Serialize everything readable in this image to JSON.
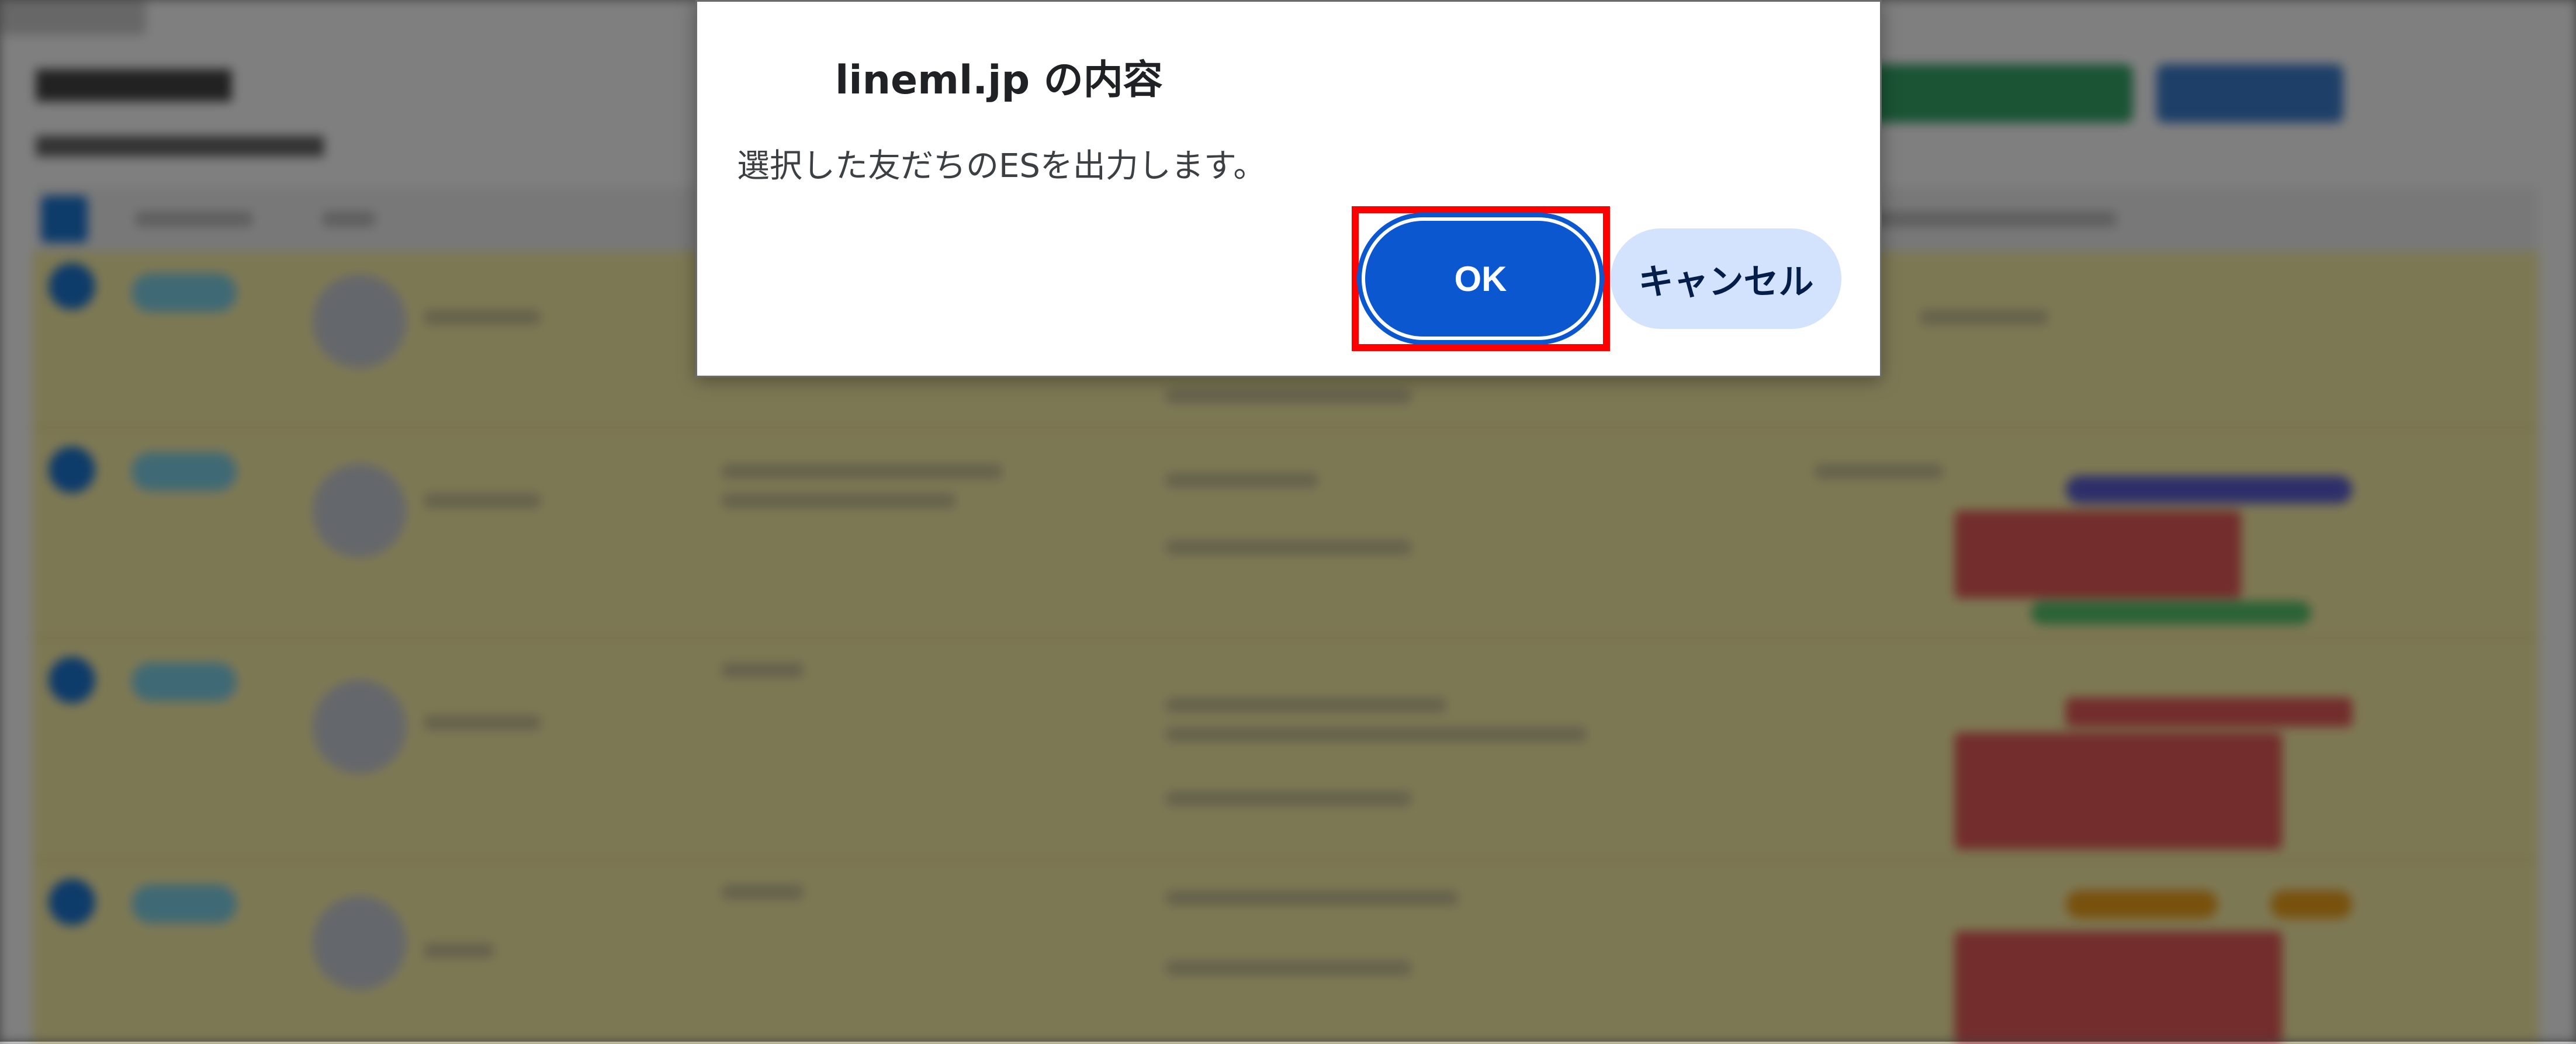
{
  "dialog": {
    "title": "lineml.jp の内容",
    "message": "選択した友だちのESを出力します。",
    "ok_label": "OK",
    "cancel_label": "キャンセル"
  },
  "colors": {
    "ok_button": "#0b57d0",
    "cancel_button": "#d3e3fd",
    "highlight": "#ff0000"
  }
}
